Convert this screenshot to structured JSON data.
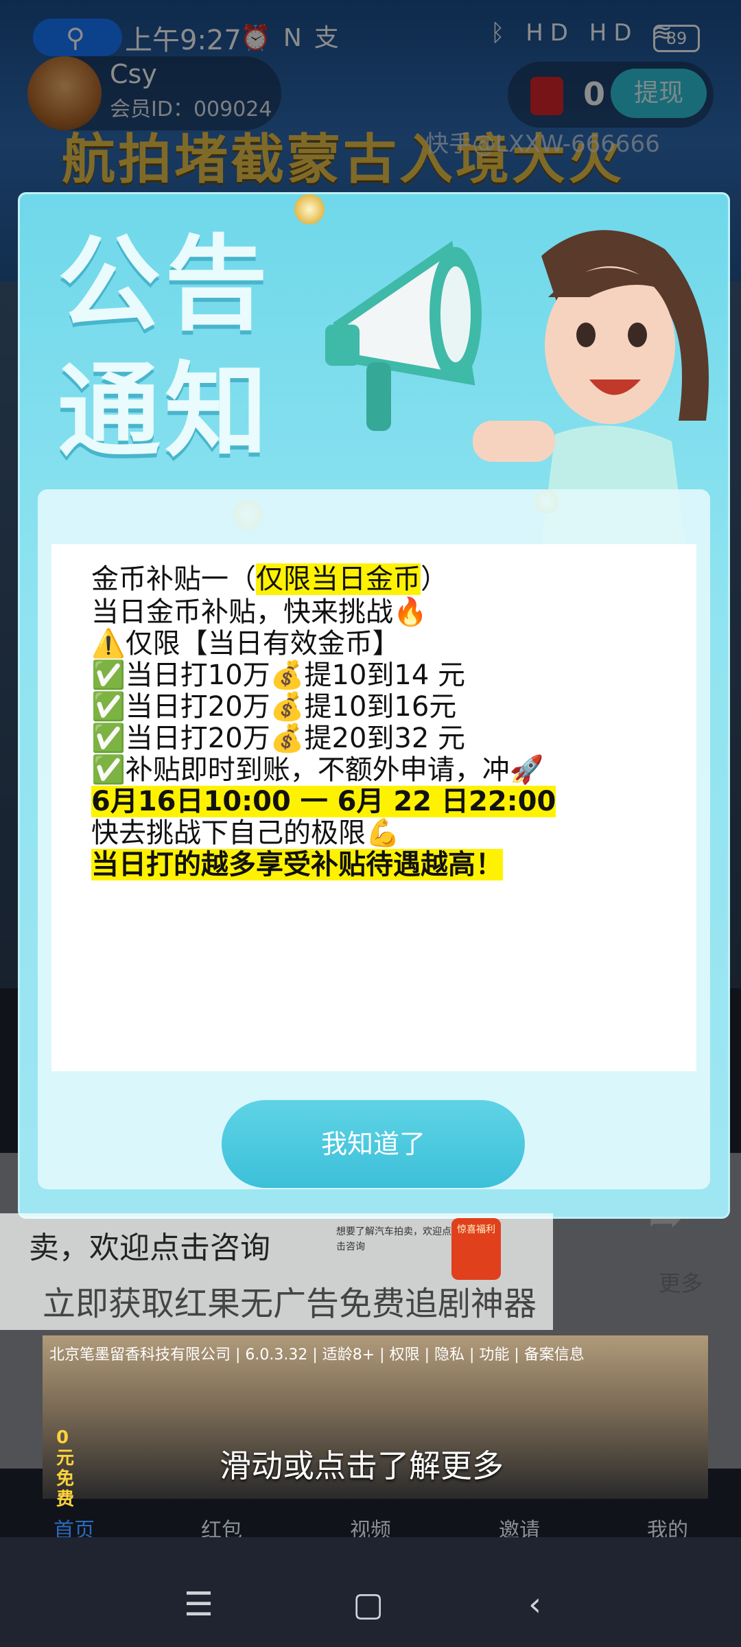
{
  "status_bar": {
    "time": "上午9:27",
    "battery": "89",
    "indicators": "HD HD"
  },
  "header": {
    "user_name": "Csy",
    "member_id": "会员ID：009024",
    "coins": "0",
    "withdraw_label": "提现"
  },
  "background": {
    "video_title": "航拍堵截蒙古入境大火",
    "watermark": "快手@LXXW-666666",
    "more_label": "更多"
  },
  "dialog": {
    "headline_1": "公告",
    "headline_2": "通知",
    "lines": [
      "金币补贴一（",
      "仅限当日金币",
      "）",
      "当日金币补贴，快来挑战🔥",
      "⚠️仅限【当日有效金币】",
      "✅当日打10万💰提10到14 元",
      "✅当日打20万💰提10到16元",
      "✅当日打20万💰提20到32 元",
      "✅补贴即时到账，不额外申请，冲🚀",
      "6月16日10:00 一 6月 22 日22:00",
      "快去挑战下自己的极限💪",
      "当日打的越多享受补贴待遇越高！"
    ],
    "ok_label": "我知道了"
  },
  "ad": {
    "line_1": "卖，欢迎点击咨询",
    "small_text": "想要了解汽车拍卖，欢迎点击咨询",
    "can_label": "惊喜福利",
    "line_2": "立即获取红果无广告免费追剧神器",
    "company": "北京笔墨留香科技有限公司 | 6.0.3.32 | 适龄8+ | 权限 | 隐私 | 功能 | 备案信息",
    "tag": "0元免费",
    "cta": "滑动或点击了解更多"
  },
  "bottom_nav": [
    {
      "label": "首页"
    },
    {
      "label": "红包"
    },
    {
      "label": "视频"
    },
    {
      "label": "邀请"
    },
    {
      "label": "我的"
    }
  ],
  "system_nav": {
    "menu": "☰",
    "home": "▢",
    "back": "‹"
  },
  "colors": {
    "accent": "#3cc0d9",
    "highlight": "#fff200",
    "active_tab": "#2a6bbd"
  }
}
